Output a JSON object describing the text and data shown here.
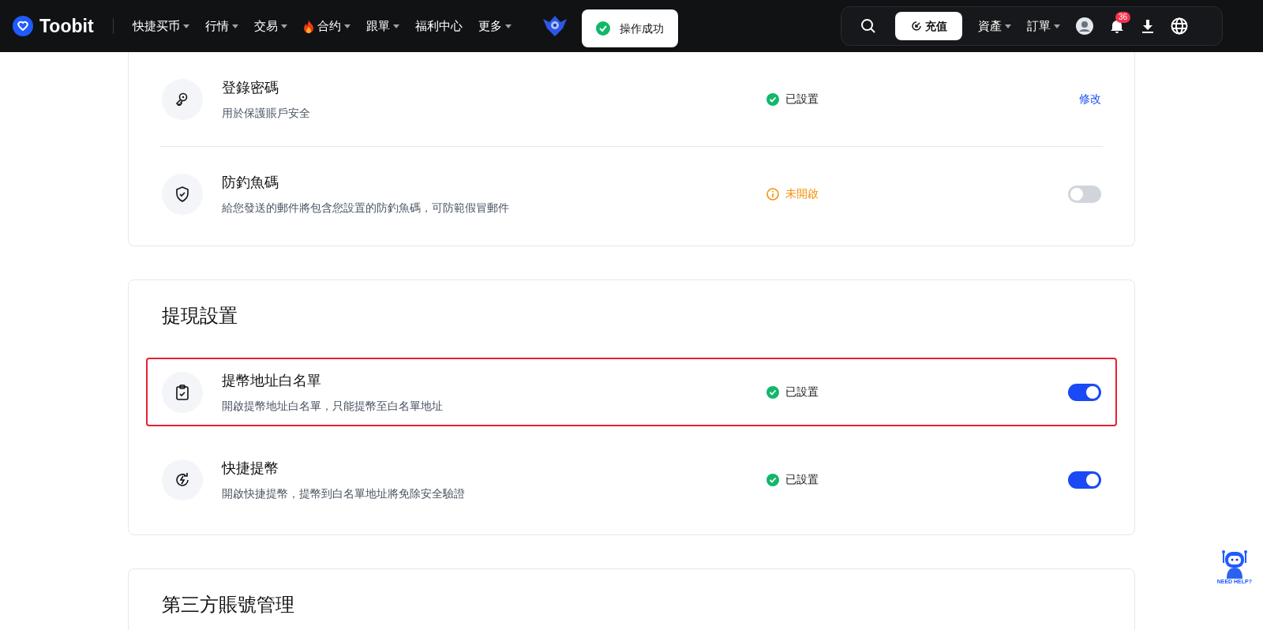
{
  "header": {
    "logo": "Toobit",
    "menu": [
      {
        "label": "快捷买币",
        "caret": true,
        "fire": false
      },
      {
        "label": "行情",
        "caret": true,
        "fire": false
      },
      {
        "label": "交易",
        "caret": true,
        "fire": false
      },
      {
        "label": "合约",
        "caret": true,
        "fire": true
      },
      {
        "label": "跟單",
        "caret": true,
        "fire": false
      },
      {
        "label": "福利中心",
        "caret": false,
        "fire": false
      },
      {
        "label": "更多",
        "caret": true,
        "fire": false
      }
    ],
    "toast": "操作成功",
    "deposit": "充值",
    "right_menu": [
      {
        "label": "資產",
        "caret": true
      },
      {
        "label": "訂單",
        "caret": true
      }
    ],
    "notification_count": "36"
  },
  "sections": [
    {
      "rows": [
        {
          "title": "登錄密碼",
          "description": "用於保護賬戶安全",
          "status": {
            "kind": "set",
            "text": "已設置"
          },
          "action": {
            "kind": "link",
            "text": "修改"
          },
          "highlighted": false
        },
        {
          "title": "防釣魚碼",
          "description": "給您發送的郵件將包含您設置的防釣魚碼，可防範假冒郵件",
          "status": {
            "kind": "unset",
            "text": "未開啟"
          },
          "action": {
            "kind": "toggle",
            "on": false
          },
          "highlighted": false
        }
      ]
    },
    {
      "title": "提現設置",
      "rows": [
        {
          "title": "提幣地址白名單",
          "description": "開啟提幣地址白名單，只能提幣至白名單地址",
          "status": {
            "kind": "set",
            "text": "已設置"
          },
          "action": {
            "kind": "toggle",
            "on": true
          },
          "highlighted": true
        },
        {
          "title": "快捷提幣",
          "description": "開啟快捷提幣，提幣到白名單地址將免除安全驗證",
          "status": {
            "kind": "set",
            "text": "已設置"
          },
          "action": {
            "kind": "toggle",
            "on": true
          },
          "highlighted": false
        }
      ]
    },
    {
      "title": "第三方賬號管理"
    }
  ],
  "help_widget": "NEED HELP?"
}
